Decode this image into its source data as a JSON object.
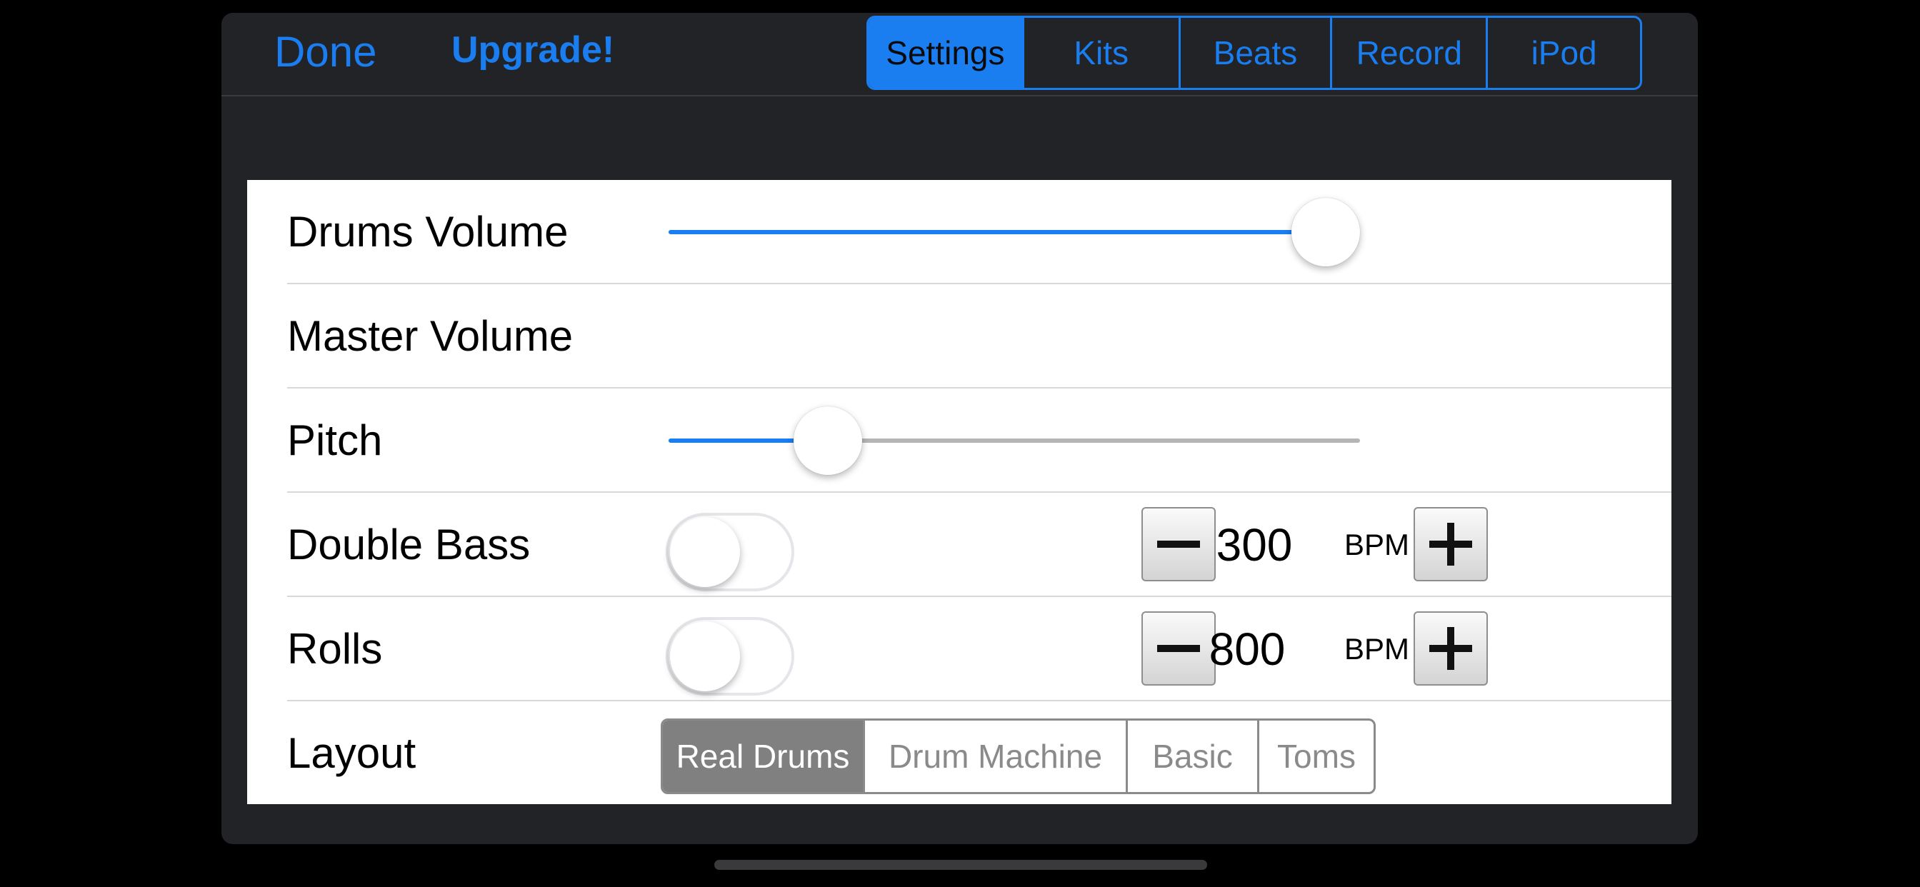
{
  "header": {
    "done_label": "Done",
    "upgrade_label": "Upgrade!",
    "tabs": [
      {
        "label": "Settings",
        "active": true
      },
      {
        "label": "Kits",
        "active": false
      },
      {
        "label": "Beats",
        "active": false
      },
      {
        "label": "Record",
        "active": false
      },
      {
        "label": "iPod",
        "active": false
      }
    ]
  },
  "settings": {
    "drums_volume": {
      "label": "Drums Volume",
      "value_fraction": 0.95
    },
    "master_volume": {
      "label": "Master Volume"
    },
    "pitch": {
      "label": "Pitch",
      "value_fraction": 0.23
    },
    "double_bass": {
      "label": "Double Bass",
      "enabled": false,
      "bpm": "300",
      "unit": "BPM"
    },
    "rolls": {
      "label": "Rolls",
      "enabled": false,
      "bpm": "800",
      "unit": "BPM"
    },
    "layout": {
      "label": "Layout",
      "options": [
        {
          "label": "Real Drums",
          "active": true
        },
        {
          "label": "Drum Machine",
          "active": false
        },
        {
          "label": "Basic",
          "active": false
        },
        {
          "label": "Toms",
          "active": false
        }
      ]
    }
  },
  "colors": {
    "accent": "#1a7df0",
    "panel_bg": "#ffffff",
    "sheet_bg": "#222326",
    "layout_active": "#808080"
  }
}
